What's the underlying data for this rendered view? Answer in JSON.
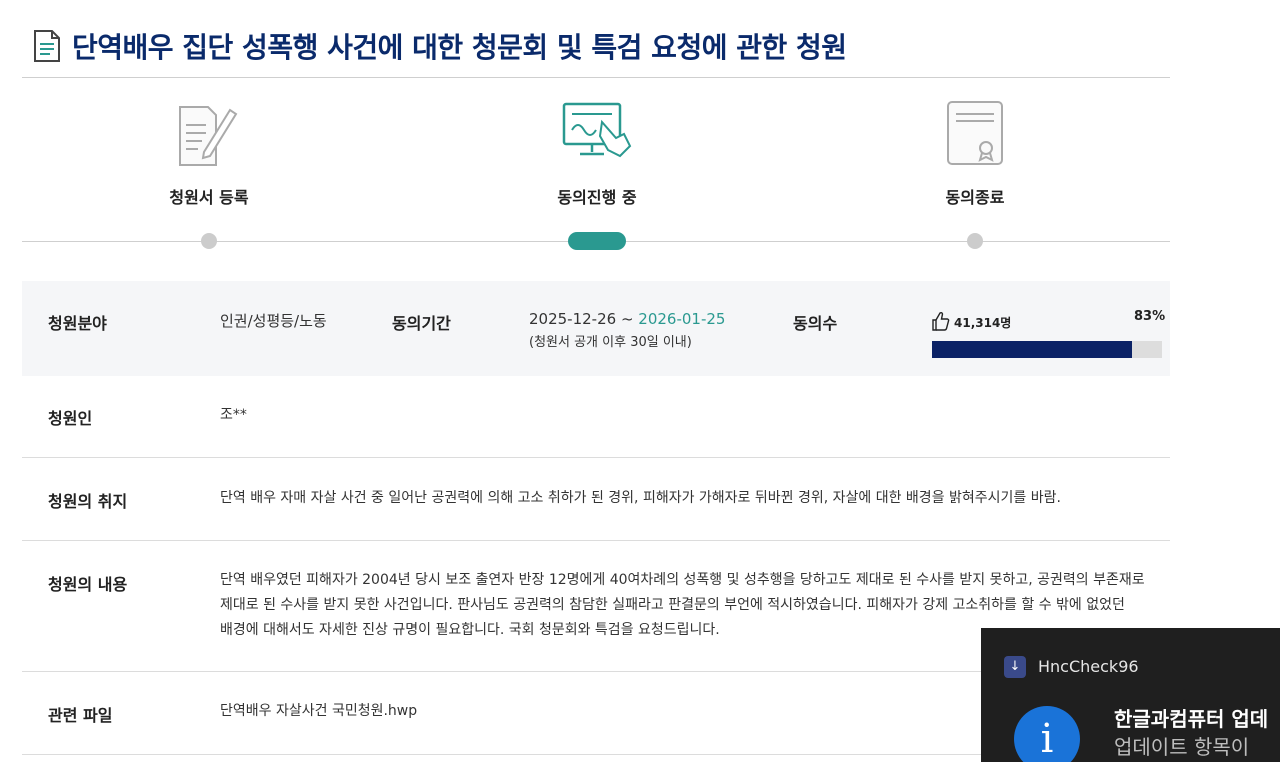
{
  "page": {
    "title": "단역배우 집단 성폭행 사건에 대한 청문회 및 특검 요청에 관한 청원",
    "title_icon": "document-icon"
  },
  "steps": [
    {
      "label": "청원서 등록",
      "icon": "petition-write-icon",
      "state": "done"
    },
    {
      "label": "동의진행 중",
      "icon": "consent-monitor-icon",
      "state": "active"
    },
    {
      "label": "동의종료",
      "icon": "certificate-icon",
      "state": "pending"
    }
  ],
  "summary": {
    "field_label": "청원분야",
    "field_value": "인권/성평등/노동",
    "period_label": "동의기간",
    "period_start": "2025-12-26 ~ ",
    "period_end": "2026-01-25",
    "period_note": "(청원서 공개 이후 30일 이내)",
    "count_label": "동의수",
    "count_value": "41,314명",
    "percent_text": "83%",
    "progress_fraction": 0.87
  },
  "details": {
    "petitioner_label": "청원인",
    "petitioner_value": "조**",
    "purpose_label": "청원의 취지",
    "purpose_value": "단역 배우 자매 자살 사건 중 일어난 공권력에 의해 고소 취하가 된 경위, 피해자가 가해자로 뒤바뀐 경위, 자살에 대한 배경을 밝혀주시기를 바람.",
    "content_label": "청원의 내용",
    "content_lines": [
      "단역 배우였던 피해자가 2004년 당시 보조 출연자 반장 12명에게 40여차례의 성폭행 및 성추행을 당하고도 제대로 된 수사를 받지 못하고, 공권력의 부존재로",
      "제대로 된  수사를 받지 못한  사건입니다.  판사님도 공권력의 참담한 실패라고 판결문의 부언에 적시하였습니다. 피해자가 강제 고소취하를 할 수 밖에 없었던",
      "배경에 대해서도 자세한 진상 규명이 필요합니다. 국회 청문회와 특검을 요청드립니다."
    ],
    "file_label": "관련 파일",
    "file_name": "단역배우 자살사건 국민청원.hwp"
  },
  "toast": {
    "app_name": "HncCheck96",
    "title": "한글과컴퓨터 업데",
    "body": "업데이트 항목이",
    "icon": "info-icon",
    "accent": "#1a73d8"
  },
  "colors": {
    "title": "#0a2a6b",
    "teal": "#2a9990",
    "progress": "#0b2266"
  }
}
